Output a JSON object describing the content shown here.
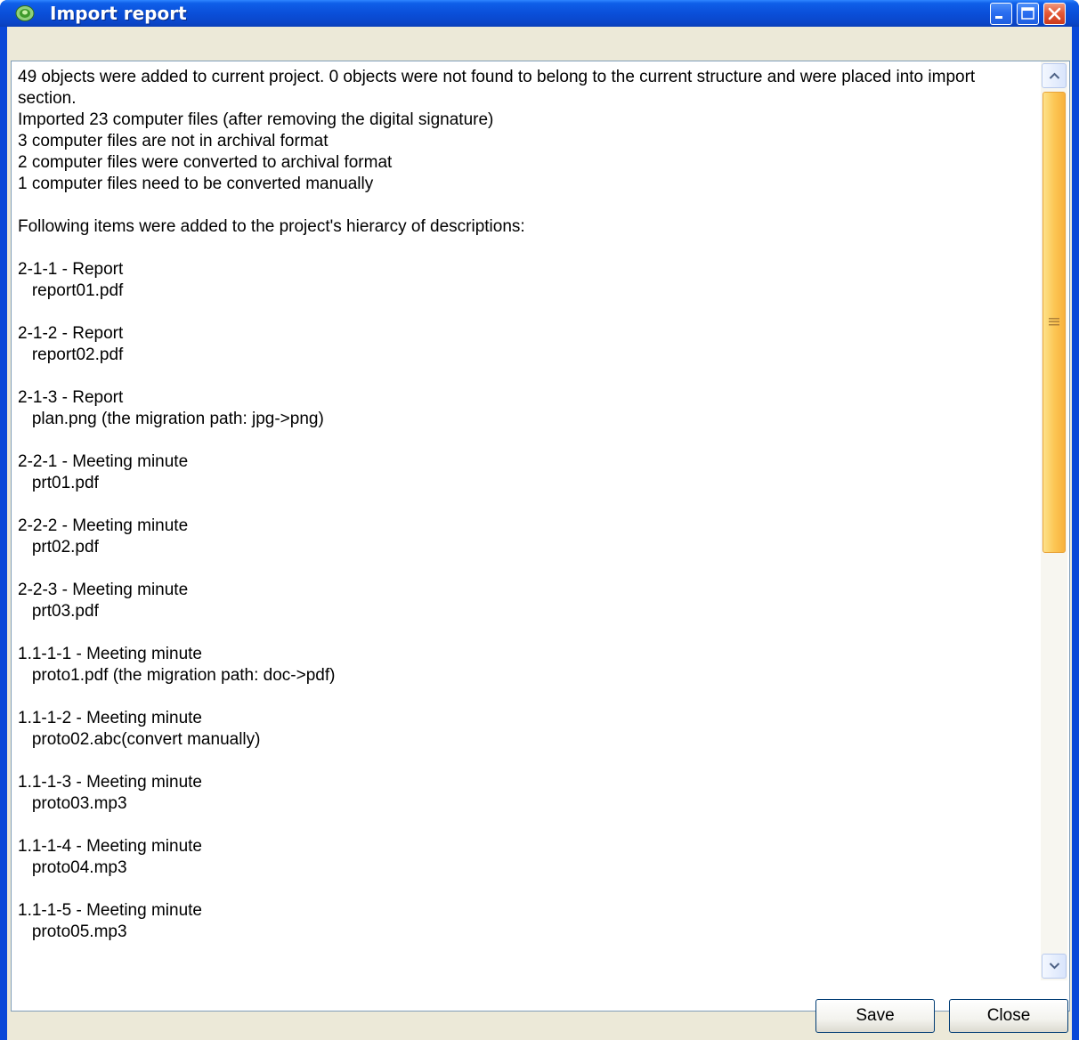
{
  "window": {
    "title": "Import report",
    "controls": {
      "minimize_icon": "minimize-icon",
      "maximize_icon": "maximize-icon",
      "close_icon": "close-icon"
    },
    "colors": {
      "title_bar": "#0a4fd9",
      "close_button": "#e35a38",
      "scroll_thumb": "#fcc755",
      "frame_body": "#ece9d8"
    }
  },
  "report": {
    "text": "49 objects were added to current project. 0 objects were not found to belong to the current structure and were placed into import section.\nImported 23 computer files (after removing the digital signature)\n3 computer files are not in archival format\n2 computer files were converted to archival format\n1 computer files need to be converted manually\n\nFollowing items were added to the project's hierarcy of descriptions:\n\n2-1-1 - Report\n   report01.pdf\n\n2-1-2 - Report\n   report02.pdf\n\n2-1-3 - Report\n   plan.png (the migration path: jpg->png)\n\n2-2-1 - Meeting minute\n   prt01.pdf\n\n2-2-2 - Meeting minute\n   prt02.pdf\n\n2-2-3 - Meeting minute\n   prt03.pdf\n\n1.1-1-1 - Meeting minute\n   proto1.pdf (the migration path: doc->pdf)\n\n1.1-1-2 - Meeting minute\n   proto02.abc(convert manually)\n\n1.1-1-3 - Meeting minute\n   proto03.mp3\n\n1.1-1-4 - Meeting minute\n   proto04.mp3\n\n1.1-1-5 - Meeting minute\n   proto05.mp3"
  },
  "buttons": {
    "save": "Save",
    "close": "Close"
  }
}
